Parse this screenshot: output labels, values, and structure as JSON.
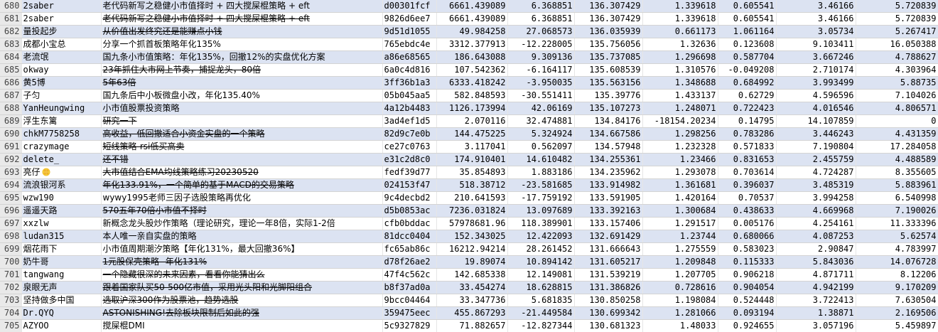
{
  "rows": [
    {
      "n": "680",
      "name": "2saber",
      "strat": "老代码新写之稳健小市值择时 + 四大搅屎棍策略 + eft",
      "strike": false,
      "id": "d00301fcf",
      "v1": "6661.439089",
      "v2": "6.368851",
      "v3": "136.307429",
      "v4": "1.339618",
      "v5": "0.605541",
      "v6": "3.46166",
      "v7": "5.720839"
    },
    {
      "n": "681",
      "name": "2saber",
      "strat": "老代码新写之稳健小市值择时 + 四大搅屎棍策略 + eft",
      "strike": true,
      "id": "9826d6ee7",
      "v1": "6661.439089",
      "v2": "6.368851",
      "v3": "136.307429",
      "v4": "1.339618",
      "v5": "0.605541",
      "v6": "3.46166",
      "v7": "5.720839"
    },
    {
      "n": "682",
      "name": "量投起步",
      "strat": "从价值出发终究还是能赚点小钱",
      "strike": true,
      "id": "9d51d1055",
      "v1": "49.984258",
      "v2": "27.068573",
      "v3": "136.035939",
      "v4": "0.661173",
      "v5": "1.061164",
      "v6": "3.05734",
      "v7": "5.267417"
    },
    {
      "n": "683",
      "name": "成都小宝总",
      "strat": "分享一个抓首板策略年化135%",
      "strike": false,
      "id": "765ebdc4e",
      "v1": "3312.377913",
      "v2": "-12.228005",
      "v3": "135.756056",
      "v4": "1.32636",
      "v5": "0.123608",
      "v6": "9.103411",
      "v7": "16.050388"
    },
    {
      "n": "684",
      "name": "老流氓",
      "strat": "国九条小市值策略：年化135%，回撤12%的实盘优化方案",
      "strike": false,
      "id": "a86e68565",
      "v1": "186.643088",
      "v2": "9.309136",
      "v3": "135.737085",
      "v4": "1.296698",
      "v5": "0.587704",
      "v6": "3.667246",
      "v7": "4.788627"
    },
    {
      "n": "685",
      "name": "okway",
      "strat": "23年抓住大市网上节奏，捕捉龙头，80倍",
      "strike": true,
      "id": "6a0c4d816",
      "v1": "107.542362",
      "v2": "-6.164117",
      "v3": "135.608539",
      "v4": "1.310576",
      "v5": "-0.049208",
      "v6": "2.710174",
      "v7": "4.303964"
    },
    {
      "n": "686",
      "name": "黄5博",
      "strat": "5年63倍",
      "strike": true,
      "id": "3ff36b1a3",
      "v1": "6333.418242",
      "v2": "-3.950035",
      "v3": "135.563156",
      "v4": "1.348688",
      "v5": "0.684992",
      "v6": "3.993499",
      "v7": "5.88735"
    },
    {
      "n": "687",
      "name": "子匀",
      "strat": "国九条后中小板微盘小改，年化135.40%",
      "strike": false,
      "id": "05b045aa5",
      "v1": "582.848593",
      "v2": "-30.551411",
      "v3": "135.39776",
      "v4": "1.433137",
      "v5": "0.62729",
      "v6": "4.596596",
      "v7": "7.104026"
    },
    {
      "n": "688",
      "name": "YanHeungwing",
      "strat": "小市值股票投资策略",
      "strike": false,
      "id": "4a12b4483",
      "v1": "1126.173994",
      "v2": "42.06169",
      "v3": "135.107273",
      "v4": "1.248071",
      "v5": "0.722423",
      "v6": "4.016546",
      "v7": "4.806571"
    },
    {
      "n": "689",
      "name": "浮生东篱",
      "strat": "研究一下",
      "strike": true,
      "id": "3ad4ef1d5",
      "v1": "2.070116",
      "v2": "32.474881",
      "v3": "134.84176",
      "v4": "-18154.20234",
      "v5": "0.14795",
      "v6": "14.107859",
      "v7": "0"
    },
    {
      "n": "690",
      "name": "chkM7758258",
      "strat": "高收益，低回撤适合小资金实盘的一个策略",
      "strike": true,
      "id": "82d9c7e0b",
      "v1": "144.475225",
      "v2": "5.324924",
      "v3": "134.667586",
      "v4": "1.298256",
      "v5": "0.783286",
      "v6": "3.446243",
      "v7": "4.431359"
    },
    {
      "n": "691",
      "name": "crazymage",
      "strat": "短线策略-rsi低买高卖",
      "strike": true,
      "id": "ce27c0763",
      "v1": "3.117041",
      "v2": "0.562097",
      "v3": "134.57948",
      "v4": "1.232328",
      "v5": "0.571833",
      "v6": "7.190804",
      "v7": "17.284058"
    },
    {
      "n": "692",
      "name": "delete_",
      "strat": "还不错",
      "strike": true,
      "id": "e31c2d8c0",
      "v1": "174.910401",
      "v2": "14.610482",
      "v3": "134.255361",
      "v4": "1.23466",
      "v5": "0.831653",
      "v6": "2.455759",
      "v7": "4.488589"
    },
    {
      "n": "693",
      "name": "亮仔",
      "strat": "大市值结合EMA均线策略练习20230520",
      "strike": true,
      "id": "fedf39d77",
      "v1": "35.854893",
      "v2": "1.883186",
      "v3": "134.235962",
      "v4": "1.293078",
      "v5": "0.703614",
      "v6": "4.724287",
      "v7": "8.355605",
      "badge": true
    },
    {
      "n": "694",
      "name": "流浪银河系",
      "strat": "年化133.91%，一个简单的基于MACD的交易策略",
      "strike": true,
      "id": "024153f47",
      "v1": "518.38712",
      "v2": "-23.581685",
      "v3": "133.914982",
      "v4": "1.361681",
      "v5": "0.396037",
      "v6": "3.485319",
      "v7": "5.883961"
    },
    {
      "n": "695",
      "name": "wzw190",
      "strat": "wywy1995老师三因子选股策略再优化",
      "strike": false,
      "id": "9c4decbd2",
      "v1": "210.641593",
      "v2": "-17.759192",
      "v3": "133.591905",
      "v4": "1.420164",
      "v5": "0.70537",
      "v6": "3.994258",
      "v7": "6.540998"
    },
    {
      "n": "696",
      "name": "遥遥天路",
      "strat": "570五年70倍小市值不择时",
      "strike": true,
      "id": "d5b0853ac",
      "v1": "7236.031824",
      "v2": "13.097689",
      "v3": "133.392163",
      "v4": "1.300684",
      "v5": "0.438633",
      "v6": "4.669968",
      "v7": "7.190026"
    },
    {
      "n": "697",
      "name": "xxzlw",
      "strat": "新概念龙头股炒作策略（理论研究，理论一年8倍，实际1-2倍",
      "strike": false,
      "id": "cfb0bddac",
      "v1": "57978681.96",
      "v2": "118.389901",
      "v3": "133.157406",
      "v4": "1.291517",
      "v5": "0.005176",
      "v6": "4.254161",
      "v7": "11.333396"
    },
    {
      "n": "698",
      "name": "ludan315",
      "strat": "本人唯一亲自实盘的策略",
      "strike": false,
      "id": "81dcc0404",
      "v1": "152.343025",
      "v2": "12.422093",
      "v3": "132.691429",
      "v4": "1.23744",
      "v5": "0.680066",
      "v6": "4.087253",
      "v7": "5.62574"
    },
    {
      "n": "699",
      "name": "烟花雨下",
      "strat": "小市值周期潮汐策略【年化131%，最大回撤36%】",
      "strike": false,
      "id": "fc65ab86c",
      "v1": "16212.94214",
      "v2": "28.261452",
      "v3": "131.666643",
      "v4": "1.275559",
      "v5": "0.583023",
      "v6": "2.90847",
      "v7": "4.783997"
    },
    {
      "n": "700",
      "name": "奶牛哥",
      "strat": "1元股保壳策略--年化131%",
      "strike": true,
      "id": "d78f26ae2",
      "v1": "19.89074",
      "v2": "10.894142",
      "v3": "131.605217",
      "v4": "1.209848",
      "v5": "0.115333",
      "v6": "5.843036",
      "v7": "14.076728"
    },
    {
      "n": "701",
      "name": "tangwang",
      "strat": "一个隐藏很深的未来因素，看看你能猜出么",
      "strike": true,
      "id": "47f4c562c",
      "v1": "142.685338",
      "v2": "12.149081",
      "v3": "131.539219",
      "v4": "1.207705",
      "v5": "0.906218",
      "v6": "4.871711",
      "v7": "8.12206"
    },
    {
      "n": "702",
      "name": "泉眼无声",
      "strat": "跟着国家队买50-500亿市值，采用光头阳和光脚阳组合",
      "strike": true,
      "id": "b8f37ad0a",
      "v1": "33.454274",
      "v2": "18.628815",
      "v3": "131.386826",
      "v4": "0.728616",
      "v5": "0.904054",
      "v6": "4.942199",
      "v7": "9.170209"
    },
    {
      "n": "703",
      "name": "坚持做多中国",
      "strat": "选取沪深300作为股票池，趋势选股",
      "strike": true,
      "id": "9bcc04464",
      "v1": "33.347736",
      "v2": "5.681835",
      "v3": "130.850258",
      "v4": "1.198084",
      "v5": "0.524448",
      "v6": "3.722413",
      "v7": "7.630504"
    },
    {
      "n": "704",
      "name": "Dr.QYQ",
      "strat": "ASTONISHING!去除板块限制后如此的强",
      "strike": true,
      "id": "359475eec",
      "v1": "455.867293",
      "v2": "-21.449584",
      "v3": "130.699342",
      "v4": "1.281066",
      "v5": "0.093194",
      "v6": "1.38871",
      "v7": "2.169506"
    },
    {
      "n": "705",
      "name": "AZYOO",
      "strat": "搅屎棍DMI",
      "strike": false,
      "id": "5c9327829",
      "v1": "71.882657",
      "v2": "-12.827344",
      "v3": "130.681323",
      "v4": "1.48033",
      "v5": "0.924655",
      "v6": "3.057196",
      "v7": "5.459897"
    }
  ],
  "colors": {
    "band": "#dce3f2",
    "rownum_bg": "#e9e9e9"
  },
  "icons": {
    "badge": "sun-badge-icon"
  }
}
